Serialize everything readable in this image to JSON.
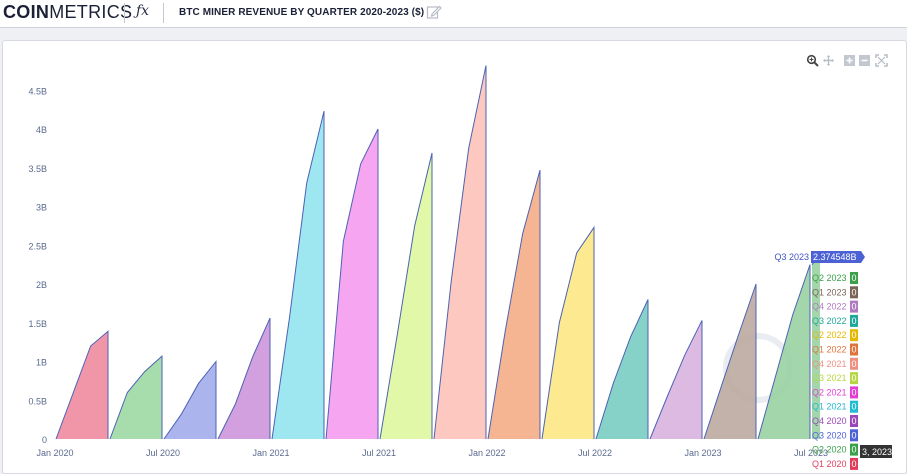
{
  "header": {
    "logo_bold": "COIN",
    "logo_light": "METRICS",
    "fx_label": "ƒx",
    "title": "BTC MINER REVENUE BY QUARTER 2020-2023 ($)"
  },
  "chart_data": {
    "type": "area",
    "title": "BTC MINER REVENUE BY QUARTER 2020-2023 ($)",
    "xlabel": "",
    "ylabel": "",
    "ylim": [
      0,
      4.9
    ],
    "y_unit": "B",
    "y_ticks": [
      "0",
      "0.5B",
      "1B",
      "1.5B",
      "2B",
      "2.5B",
      "3B",
      "3.5B",
      "4B",
      "4.5B"
    ],
    "x_ticks": [
      "Jan 2020",
      "Jul 2020",
      "Jan 2021",
      "Jul 2021",
      "Jan 2022",
      "Jul 2022",
      "Jan 2023",
      "Jul 2023"
    ],
    "grid": false,
    "legend": "right (hover labels)",
    "series": [
      {
        "name": "Q1 2020",
        "color": "#ef8aa0",
        "values": [
          0,
          0.6,
          1.2,
          1.39
        ]
      },
      {
        "name": "Q2 2020",
        "color": "#9dd9a4",
        "values": [
          0,
          0.6,
          0.87,
          1.07
        ]
      },
      {
        "name": "Q3 2020",
        "color": "#a3acec",
        "values": [
          0,
          0.32,
          0.72,
          1.0
        ]
      },
      {
        "name": "Q4 2020",
        "color": "#cd95dc",
        "values": [
          0,
          0.45,
          1.06,
          1.56
        ]
      },
      {
        "name": "Q1 2021",
        "color": "#93e3ee",
        "values": [
          0,
          1.55,
          3.3,
          4.23
        ]
      },
      {
        "name": "Q2 2021",
        "color": "#f59bef",
        "values": [
          0,
          2.55,
          3.55,
          4.0
        ]
      },
      {
        "name": "Q3 2021",
        "color": "#def7a0",
        "values": [
          0,
          1.35,
          2.75,
          3.69
        ]
      },
      {
        "name": "Q4 2021",
        "color": "#fdc2b8",
        "values": [
          0,
          2.05,
          3.75,
          4.82
        ]
      },
      {
        "name": "Q1 2022",
        "color": "#f4ad86",
        "values": [
          0,
          1.4,
          2.65,
          3.47
        ]
      },
      {
        "name": "Q2 2022",
        "color": "#fde884",
        "values": [
          0,
          1.5,
          2.4,
          2.73
        ]
      },
      {
        "name": "Q3 2022",
        "color": "#79cdc3",
        "values": [
          0,
          0.72,
          1.32,
          1.8
        ]
      },
      {
        "name": "Q4 2022",
        "color": "#d8b3df",
        "values": [
          0,
          0.55,
          1.08,
          1.53
        ]
      },
      {
        "name": "Q1 2023",
        "color": "#bcaaa0",
        "values": [
          0,
          0.68,
          1.35,
          2.0
        ]
      },
      {
        "name": "Q2 2023",
        "color": "#99d2a2",
        "values": [
          0,
          0.8,
          1.6,
          2.25
        ]
      },
      {
        "name": "Q3 2023",
        "color": "#99d2a2",
        "values": [
          2.25,
          2.374548
        ]
      }
    ],
    "hover": {
      "x_label": "Q3 2023",
      "value_label": "2.374548B",
      "date_label": "3, 2023",
      "legend_items": [
        {
          "label": "Q2 2023",
          "value": "0",
          "color": "#3aa04a"
        },
        {
          "label": "Q1 2023",
          "value": "0",
          "color": "#7a6458"
        },
        {
          "label": "Q4 2022",
          "value": "0",
          "color": "#b07ac0"
        },
        {
          "label": "Q3 2022",
          "value": "0",
          "color": "#1fa79a"
        },
        {
          "label": "Q2 2022",
          "value": "0",
          "color": "#e5b800"
        },
        {
          "label": "Q1 2022",
          "value": "0",
          "color": "#e0733c"
        },
        {
          "label": "Q4 2021",
          "value": "0",
          "color": "#ee8f80"
        },
        {
          "label": "Q3 2021",
          "value": "0",
          "color": "#b6d743"
        },
        {
          "label": "Q2 2021",
          "value": "0",
          "color": "#e23fd6"
        },
        {
          "label": "Q1 2021",
          "value": "0",
          "color": "#1fbcd2"
        },
        {
          "label": "Q4 2020",
          "value": "0",
          "color": "#9a48b8"
        },
        {
          "label": "Q3 2020",
          "value": "0",
          "color": "#4f61d8"
        },
        {
          "label": "Q2 2020",
          "value": "0",
          "color": "#3aa04a"
        },
        {
          "label": "Q1 2020",
          "value": "0",
          "color": "#e23c5c"
        }
      ]
    }
  }
}
